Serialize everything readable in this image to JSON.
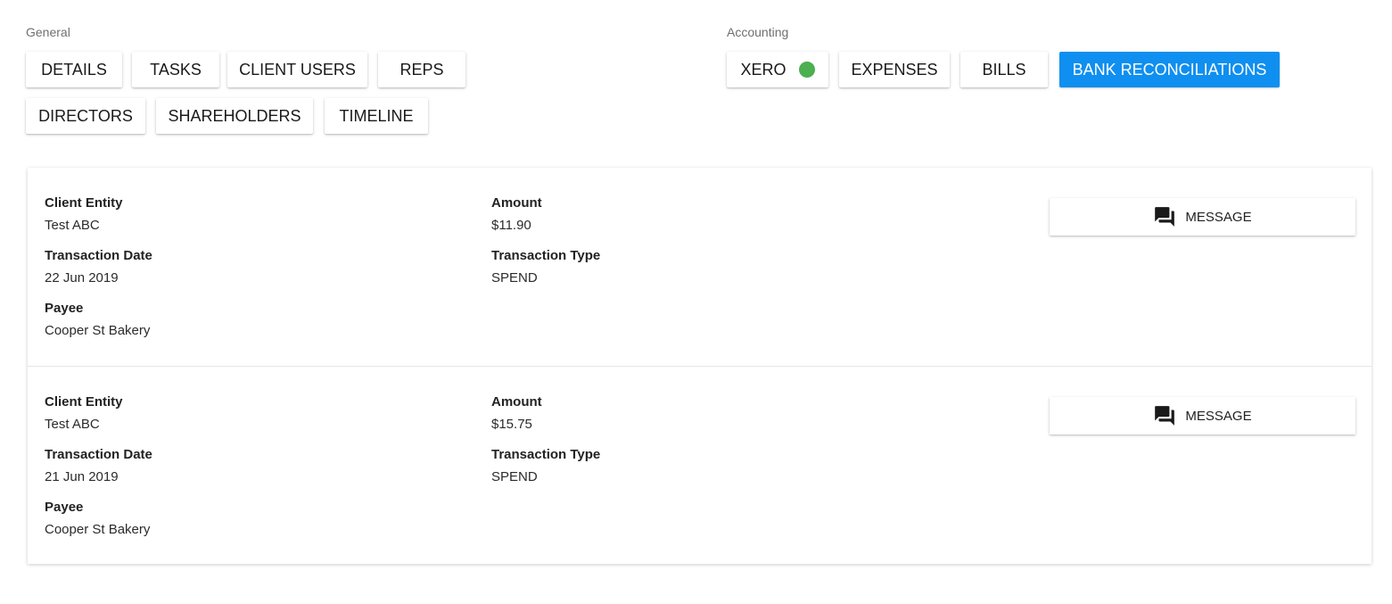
{
  "general": {
    "label": "General",
    "tabs": [
      "DETAILS",
      "TASKS",
      "CLIENT USERS",
      "REPS",
      "DIRECTORS",
      "SHAREHOLDERS",
      "TIMELINE"
    ]
  },
  "accounting": {
    "label": "Accounting",
    "tabs": [
      "XERO",
      "EXPENSES",
      "BILLS",
      "BANK RECONCILIATIONS"
    ],
    "active_tab": "BANK RECONCILIATIONS",
    "xero_status_color": "#4caf50",
    "active_color": "#0f8ff0"
  },
  "labels": {
    "client_entity": "Client Entity",
    "transaction_date": "Transaction Date",
    "payee": "Payee",
    "amount": "Amount",
    "transaction_type": "Transaction Type",
    "message_button": "MESSAGE",
    "message_icon": "chat-bubbles-icon"
  },
  "records": [
    {
      "client_entity": "Test ABC",
      "transaction_date": "22 Jun 2019",
      "payee": "Cooper St Bakery",
      "amount": "$11.90",
      "transaction_type": "SPEND"
    },
    {
      "client_entity": "Test ABC",
      "transaction_date": "21 Jun 2019",
      "payee": "Cooper St Bakery",
      "amount": "$15.75",
      "transaction_type": "SPEND"
    }
  ]
}
